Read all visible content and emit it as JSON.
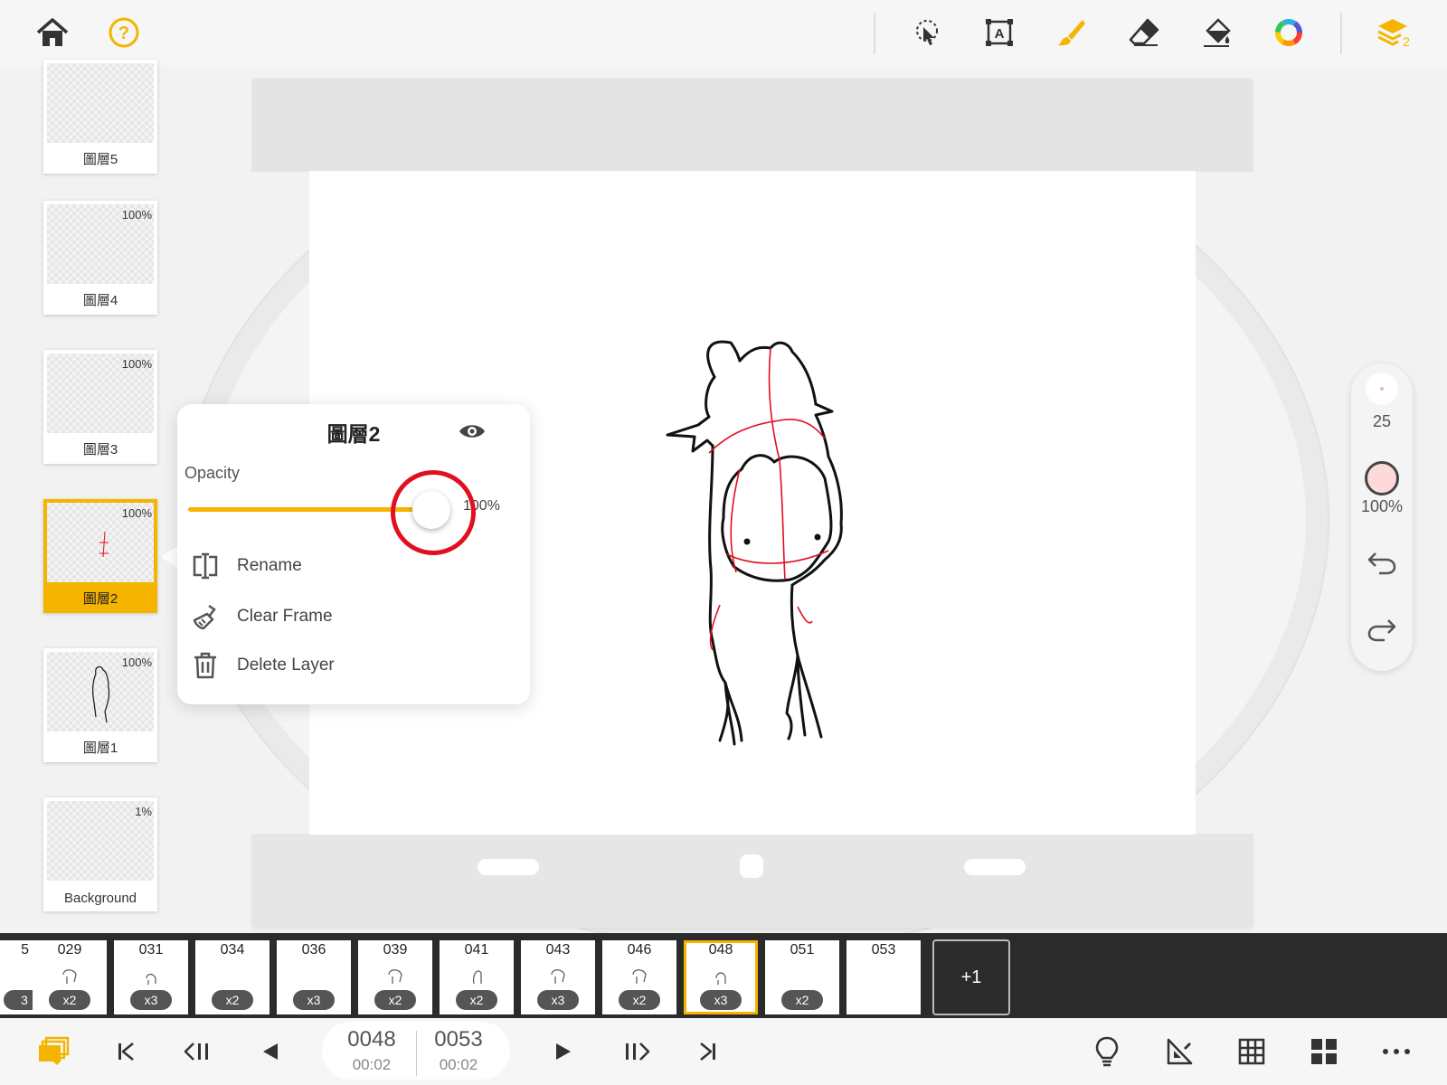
{
  "colors": {
    "accent": "#f5b400",
    "highlight": "#e01020",
    "dark": "#2b2b2b"
  },
  "layers": [
    {
      "name": "圖層5",
      "opacity": ""
    },
    {
      "name": "圖層4",
      "opacity": "100%"
    },
    {
      "name": "圖層3",
      "opacity": "100%"
    },
    {
      "name": "圖層2",
      "opacity": "100%",
      "selected": true
    },
    {
      "name": "圖層1",
      "opacity": "100%"
    },
    {
      "name": "Background",
      "opacity": "1%"
    }
  ],
  "popup": {
    "title": "圖層2",
    "opacity_label": "Opacity",
    "opacity_value": "100%",
    "opacity_fraction": 1.0,
    "menu": {
      "rename": "Rename",
      "clear_frame": "Clear Frame",
      "delete_layer": "Delete Layer"
    }
  },
  "rightbar": {
    "brush_size": "25",
    "brush_opacity": "100%"
  },
  "timeline": {
    "partial_left": {
      "num": "5",
      "badge": "3"
    },
    "frames": [
      {
        "num": "029",
        "badge": "x2"
      },
      {
        "num": "031",
        "badge": "x3"
      },
      {
        "num": "034",
        "badge": "x2"
      },
      {
        "num": "036",
        "badge": "x3"
      },
      {
        "num": "039",
        "badge": "x2"
      },
      {
        "num": "041",
        "badge": "x2"
      },
      {
        "num": "043",
        "badge": "x3"
      },
      {
        "num": "046",
        "badge": "x2"
      },
      {
        "num": "048",
        "badge": "x3",
        "current": true
      },
      {
        "num": "051",
        "badge": "x2"
      },
      {
        "num": "053",
        "badge": ""
      }
    ],
    "add_label": "+1"
  },
  "playback": {
    "current_frame": "0048",
    "current_time": "00:02",
    "total_frames": "0053",
    "total_time": "00:02"
  }
}
